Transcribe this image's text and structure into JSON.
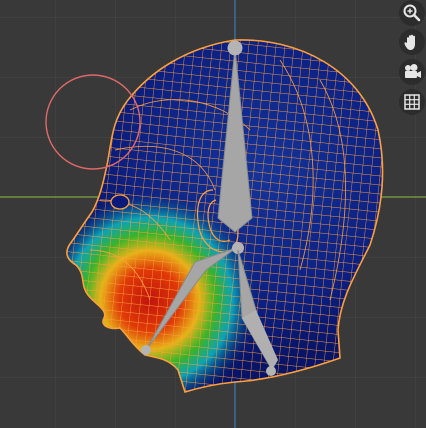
{
  "viewport": {
    "mode": "weight-paint",
    "view": "left-orthographic",
    "mesh": "head",
    "armature_bones": 3,
    "colors": {
      "background": "#393939",
      "grid": "#484848",
      "x_axis": "#80a441",
      "z_axis": "#3d79b5",
      "wire": "#ff9f3a",
      "mesh_cold": "#0a1a7a",
      "bone": "#a6a6a6",
      "brush_circle": "#e06868"
    }
  },
  "navigation_gizmo": {
    "buttons": [
      {
        "icon": "zoom-icon"
      },
      {
        "icon": "hand-pan-icon"
      },
      {
        "icon": "camera-icon"
      },
      {
        "icon": "grid-ortho-icon"
      }
    ]
  }
}
